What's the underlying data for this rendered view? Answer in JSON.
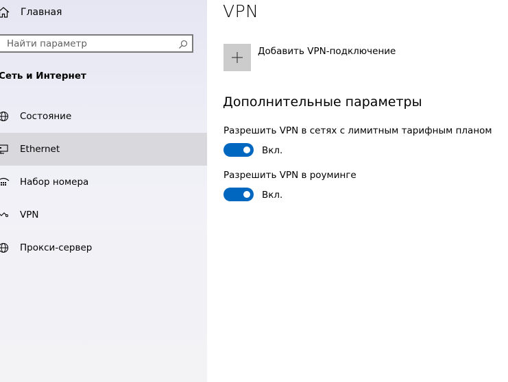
{
  "sidebar": {
    "home_label": "Главная",
    "search_placeholder": "Найти параметр",
    "search_value": "",
    "section_title": "Сеть и Интернет",
    "items": [
      {
        "label": "Состояние",
        "icon": "globe-icon"
      },
      {
        "label": "Ethernet",
        "icon": "ethernet-icon"
      },
      {
        "label": "Набор номера",
        "icon": "dialup-icon"
      },
      {
        "label": "VPN",
        "icon": "vpn-icon"
      },
      {
        "label": "Прокси-сервер",
        "icon": "globe-icon"
      }
    ],
    "selected_item": "Ethernet"
  },
  "main": {
    "title": "VPN",
    "add_vpn_label": "Добавить VPN-подключение",
    "advanced_title": "Дополнительные параметры",
    "settings": [
      {
        "label": "Разрешить VPN в сетях с лимитным тарифным планом",
        "state": "Вкл.",
        "on": true
      },
      {
        "label": "Разрешить VPN в роуминге",
        "state": "Вкл.",
        "on": true
      }
    ]
  },
  "colors": {
    "accent": "#0067c0",
    "selected_bg": "#d9d9dd",
    "add_tile_bg": "#cccccc"
  }
}
